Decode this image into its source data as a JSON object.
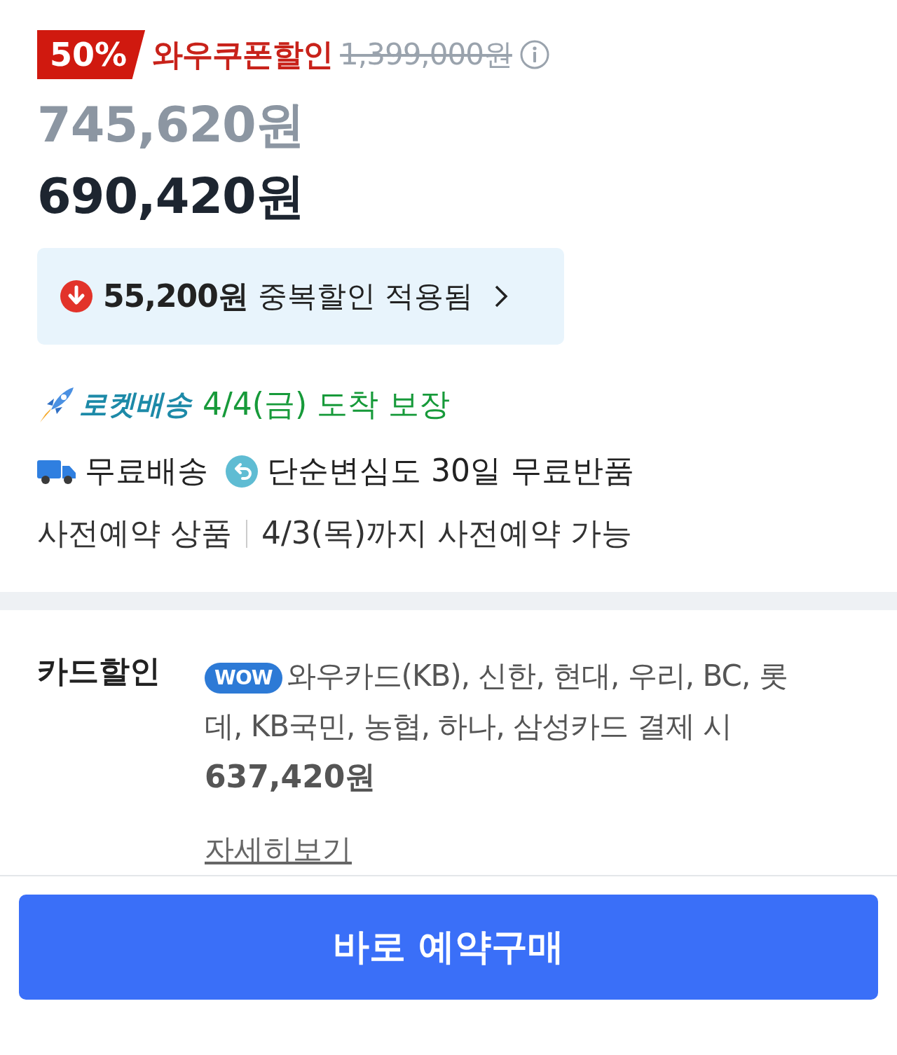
{
  "price": {
    "discount_badge": "50%",
    "coupon_label": "와우쿠폰할인",
    "original_price": "1,399,000원",
    "sale_price": "745,620원",
    "final_price": "690,420원"
  },
  "extra_discount": {
    "amount": "55,200원",
    "label": "중복할인 적용됨"
  },
  "delivery": {
    "rocket_label": "로켓배송",
    "arrival": "4/4(금) 도착 보장"
  },
  "benefits": [
    {
      "kind": "shipping",
      "label": "무료배송"
    },
    {
      "kind": "return",
      "label": "단순변심도 30일 무료반품"
    }
  ],
  "preorder": {
    "label": "사전예약 상품",
    "deadline": "4/3(목)까지 사전예약 가능"
  },
  "card_discount": {
    "title": "카드할인",
    "badge": "WOW",
    "description": "와우카드(KB), 신한, 현대, 우리, BC, 롯데, KB국민, 농협, 하나, 삼성카드 결제 시",
    "price": "637,420원",
    "details_link": "자세히보기"
  },
  "buy_button": "바로 예약구매"
}
